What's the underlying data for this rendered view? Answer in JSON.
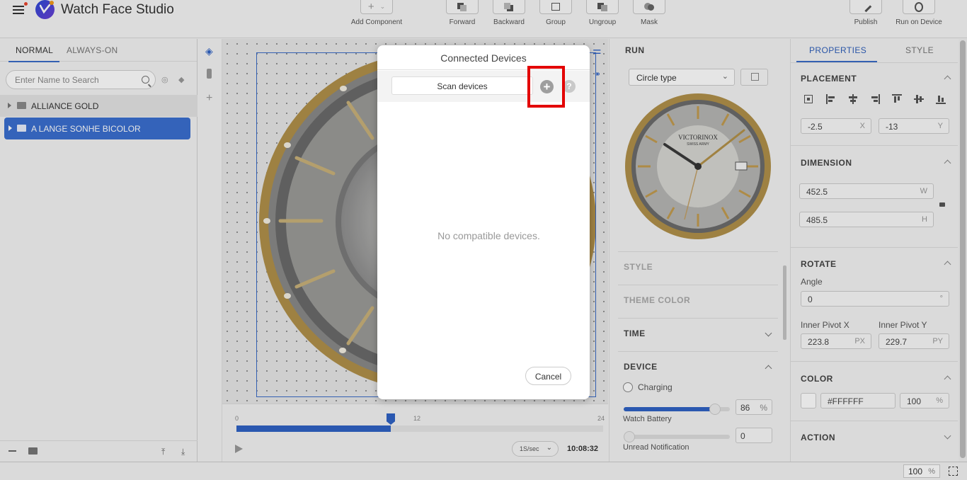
{
  "app": {
    "title": "Watch Face Studio"
  },
  "toolbar": {
    "add_component": "Add Component",
    "forward": "Forward",
    "backward": "Backward",
    "group": "Group",
    "ungroup": "Ungroup",
    "mask": "Mask",
    "publish": "Publish",
    "run_on_device": "Run on Device"
  },
  "left_panel": {
    "tabs": [
      "NORMAL",
      "ALWAYS-ON"
    ],
    "search_placeholder": "Enter Name to Search",
    "layers": [
      {
        "label": "ALLIANCE GOLD",
        "selected": false
      },
      {
        "label": "A LANGE SONHE BICOLOR",
        "selected": true
      }
    ]
  },
  "timeline": {
    "start": "0",
    "mid": "12",
    "end": "24",
    "progress": 0.42,
    "speed": "1S/sec",
    "clock": "10:08:32"
  },
  "run_panel": {
    "title": "RUN",
    "type_select": "Circle type",
    "watch_brand": "VICTORINOX",
    "watch_sub": "SWISS ARMY",
    "sections": {
      "style": "STYLE",
      "theme_color": "THEME COLOR",
      "time": "TIME",
      "device": "DEVICE"
    },
    "charging_label": "Charging",
    "battery_value": "86",
    "battery_unit": "%",
    "battery_label": "Watch Battery",
    "battery_level": 0.86,
    "unread_value": "0",
    "unread_label": "Unread Notification"
  },
  "properties": {
    "tabs": [
      "PROPERTIES",
      "STYLE"
    ],
    "placement": {
      "title": "PLACEMENT",
      "x": "-2.5",
      "x_unit": "X",
      "y": "-13",
      "y_unit": "Y"
    },
    "dimension": {
      "title": "DIMENSION",
      "w": "452.5",
      "w_unit": "W",
      "h": "485.5",
      "h_unit": "H"
    },
    "rotate": {
      "title": "ROTATE",
      "angle_label": "Angle",
      "angle": "0",
      "angle_unit": "°",
      "pivot_x_label": "Inner Pivot X",
      "pivot_y_label": "Inner Pivot Y",
      "pivot_x": "223.8",
      "pivot_y": "229.7",
      "px_unit": "PX",
      "py_unit": "PY"
    },
    "color": {
      "title": "COLOR",
      "hex": "#FFFFFF",
      "opacity": "100",
      "unit": "%"
    },
    "action": {
      "title": "ACTION"
    }
  },
  "statusbar": {
    "zoom": "100",
    "zoom_unit": "%"
  },
  "dialog": {
    "title": "Connected Devices",
    "scan_button": "Scan devices",
    "add_icon": "+",
    "help_icon": "?",
    "empty_message": "No compatible devices.",
    "cancel_button": "Cancel"
  },
  "colors": {
    "accent": "#3a6bc7",
    "highlight": "#e30000",
    "bezel": "#b0904a"
  }
}
